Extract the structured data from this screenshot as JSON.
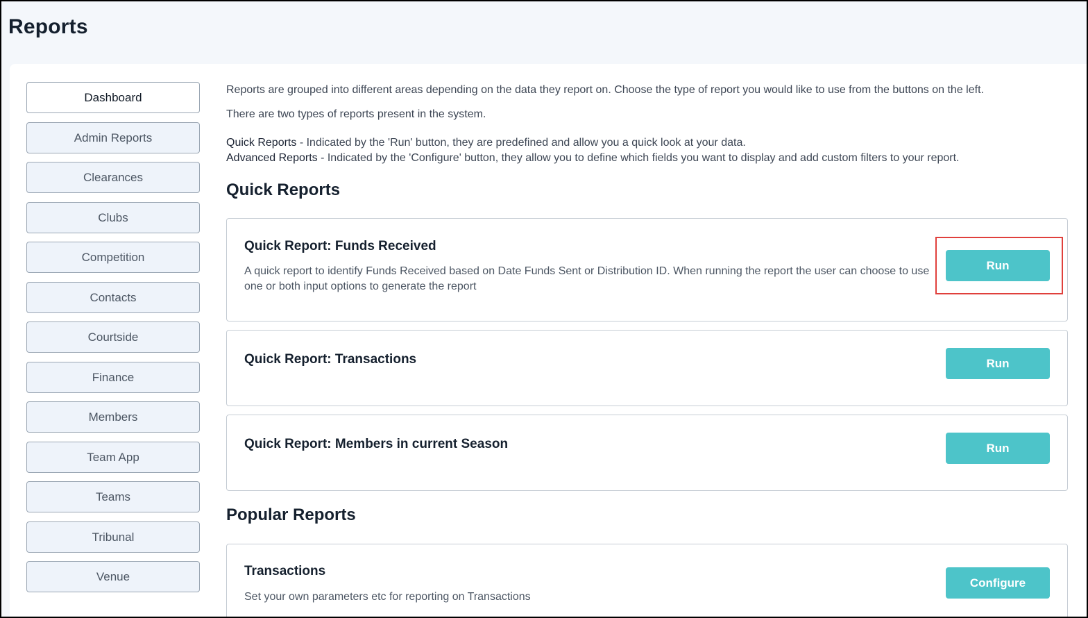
{
  "page": {
    "title": "Reports"
  },
  "sidebar": {
    "items": [
      {
        "label": "Dashboard",
        "active": true
      },
      {
        "label": "Admin Reports",
        "active": false
      },
      {
        "label": "Clearances",
        "active": false
      },
      {
        "label": "Clubs",
        "active": false
      },
      {
        "label": "Competition",
        "active": false
      },
      {
        "label": "Contacts",
        "active": false
      },
      {
        "label": "Courtside",
        "active": false
      },
      {
        "label": "Finance",
        "active": false
      },
      {
        "label": "Members",
        "active": false
      },
      {
        "label": "Team App",
        "active": false
      },
      {
        "label": "Teams",
        "active": false
      },
      {
        "label": "Tribunal",
        "active": false
      },
      {
        "label": "Venue",
        "active": false
      }
    ]
  },
  "intro": {
    "line1": "Reports are grouped into different areas depending on the data they report on. Choose the type of report you would like to use from the buttons on the left.",
    "line2": "There are two types of reports present in the system.",
    "quick_label": "Quick Reports",
    "quick_text": " - Indicated by the 'Run' button, they are predefined and allow you a quick look at your data.",
    "advanced_label": "Advanced Reports",
    "advanced_text": " - Indicated by the 'Configure' button, they allow you to define which fields you want to display and add custom filters to your report."
  },
  "quick_reports": {
    "heading": "Quick Reports",
    "cards": [
      {
        "title": "Quick Report: Funds Received",
        "description": "A quick report to identify Funds Received based on Date Funds Sent or Distribution ID. When running the report the user can choose to use one or both input options to generate the report",
        "button": "Run"
      },
      {
        "title": "Quick Report: Transactions",
        "description": "",
        "button": "Run"
      },
      {
        "title": "Quick Report: Members in current Season",
        "description": "",
        "button": "Run"
      }
    ]
  },
  "popular_reports": {
    "heading": "Popular Reports",
    "cards": [
      {
        "title": "Transactions",
        "description": "Set your own parameters etc for reporting on Transactions",
        "button": "Configure"
      }
    ]
  },
  "colors": {
    "accent": "#4dc4c9",
    "highlight_border": "#e0403c",
    "sidebar_bg": "#eef3fa",
    "page_bg": "#f4f7fb"
  }
}
